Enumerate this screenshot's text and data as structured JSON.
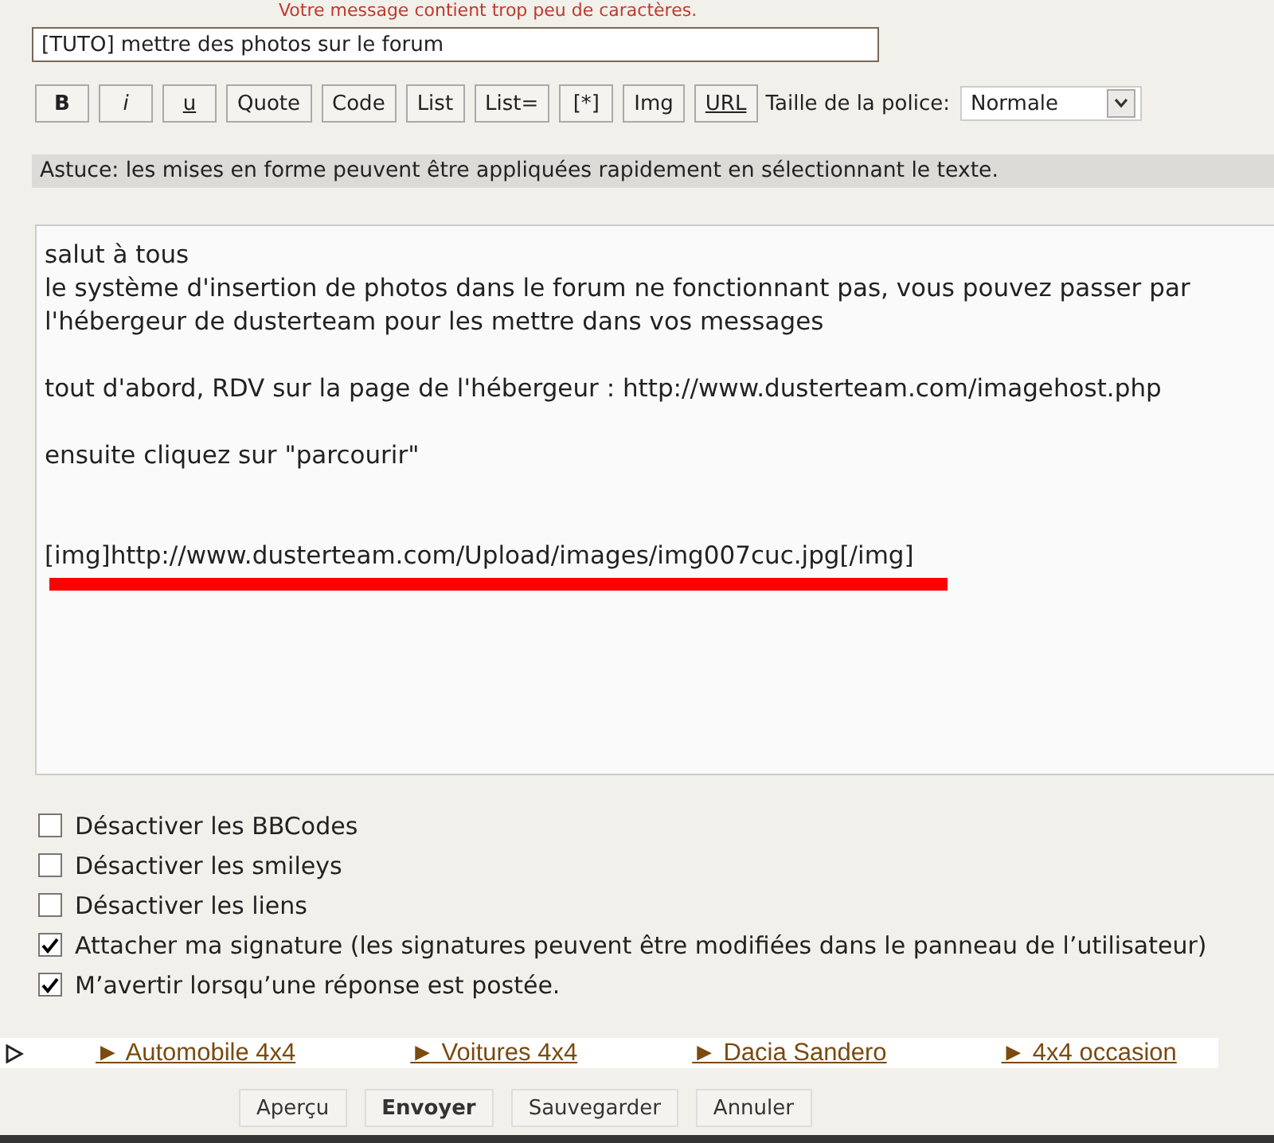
{
  "error_message": "Votre message contient trop peu de caractères.",
  "subject": {
    "value": "[TUTO] mettre des photos sur le forum"
  },
  "toolbar": {
    "buttons": [
      {
        "label": "B",
        "kind": "bold"
      },
      {
        "label": "i",
        "kind": "italic"
      },
      {
        "label": "u",
        "kind": "underline"
      },
      {
        "label": "Quote",
        "kind": "plain"
      },
      {
        "label": "Code",
        "kind": "plain"
      },
      {
        "label": "List",
        "kind": "plain"
      },
      {
        "label": "List=",
        "kind": "plain"
      },
      {
        "label": "[*]",
        "kind": "plain"
      },
      {
        "label": "Img",
        "kind": "plain"
      },
      {
        "label": "URL",
        "kind": "underline"
      }
    ],
    "font_size_label": "Taille de la police:",
    "font_size_value": "Normale"
  },
  "tip": "Astuce: les mises en forme peuvent être appliquées rapidement en sélectionnant le texte.",
  "message": {
    "paragraphs": [
      {
        "kind": "text",
        "lines": [
          "salut à tous",
          "le système d'insertion de photos dans le forum ne fonctionnant pas, vous pouvez passer par",
          "l'hébergeur de dusterteam pour les mettre dans vos messages"
        ]
      },
      {
        "kind": "text",
        "lines": [
          "tout d'abord, RDV sur la page de l'hébergeur : http://www.dusterteam.com/imagehost.php"
        ]
      },
      {
        "kind": "text",
        "lines": [
          "ensuite cliquez sur \"parcourir\""
        ]
      },
      {
        "kind": "bbcode",
        "lines": [
          "[img]http://www.dusterteam.com/Upload/images/img007cuc.jpg[/img]"
        ]
      }
    ]
  },
  "options": [
    {
      "label": "Désactiver les BBCodes",
      "checked": false
    },
    {
      "label": "Désactiver les smileys",
      "checked": false
    },
    {
      "label": "Désactiver les liens",
      "checked": false
    },
    {
      "label": "Attacher ma signature (les signatures peuvent être modifiées dans le panneau de l’utilisateur)",
      "checked": true
    },
    {
      "label": "M’avertir lorsqu’une réponse est postée.",
      "checked": true
    }
  ],
  "ad_links": [
    "► Automobile 4x4",
    "► Voitures 4x4",
    "► Dacia Sandero",
    "► 4x4 occasion"
  ],
  "buttons": [
    {
      "label": "Aperçu",
      "primary": false
    },
    {
      "label": "Envoyer",
      "primary": true
    },
    {
      "label": "Sauvegarder",
      "primary": false
    },
    {
      "label": "Annuler",
      "primary": false
    }
  ]
}
